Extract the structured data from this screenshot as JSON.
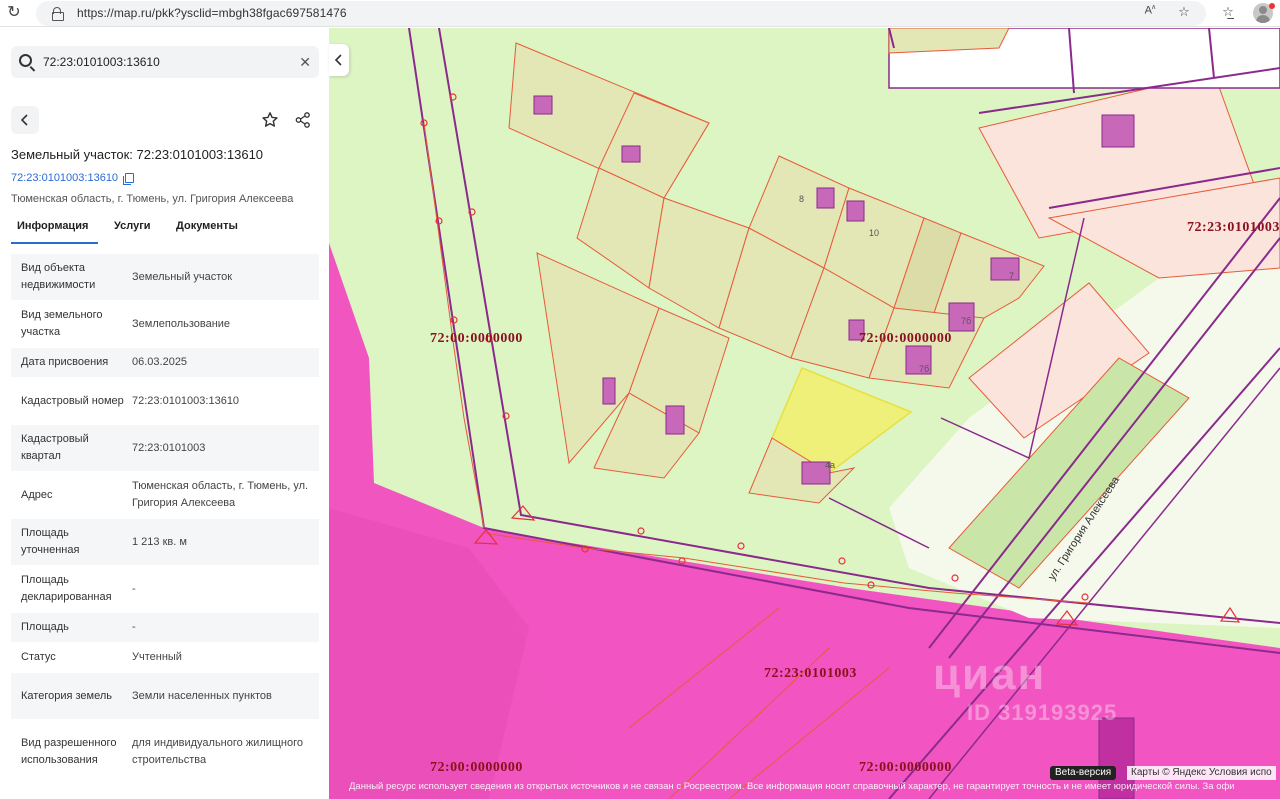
{
  "browser": {
    "url": "https://map.ru/pkk?ysclid=mbgh38fgac697581476",
    "reader_icon": "reader-mode-icon",
    "favorite_icon": "star-icon",
    "collections_icon": "collections-icon"
  },
  "sidebar": {
    "search": {
      "value": "72:23:0101003:13610"
    },
    "title": "Земельный участок: 72:23:0101003:13610",
    "cadastral_link": "72:23:0101003:13610",
    "address": "Тюменская область, г. Тюмень, ул. Григория Алексеева",
    "tabs": [
      "Информация",
      "Услуги",
      "Документы"
    ],
    "rows": [
      {
        "key": "Вид объекта недвижимости",
        "value": "Земельный участок"
      },
      {
        "key": "Вид земельного участка",
        "value": "Землепользование"
      },
      {
        "key": "Дата присвоения",
        "value": "06.03.2025"
      },
      {
        "key": "Кадастровый номер",
        "value": "72:23:0101003:13610"
      },
      {
        "key": "Кадастровый квартал",
        "value": "72:23:0101003"
      },
      {
        "key": "Адрес",
        "value": "Тюменская область, г. Тюмень, ул. Григория Алексеева"
      },
      {
        "key": "Площадь уточненная",
        "value": "1 213 кв. м"
      },
      {
        "key": "Площадь декларированная",
        "value": "-"
      },
      {
        "key": "Площадь",
        "value": "-"
      },
      {
        "key": "Статус",
        "value": "Учтенный"
      },
      {
        "key": "Категория земель",
        "value": "Земли населенных пунктов"
      },
      {
        "key": "Вид разрешенного использования",
        "value": "для индивидуального жилищного строительства"
      }
    ]
  },
  "map": {
    "quarter_labels": [
      "72:00:0000000",
      "72:00:0000000",
      "72:23:0101003",
      "72:00:0000000",
      "72:00:0000000",
      "72:23:0101003"
    ],
    "parcel_numbers": [
      "8",
      "10",
      "7",
      "7б",
      "7б",
      "4а"
    ],
    "street": "ул. Григория Алексеева",
    "watermark_logo": "циан",
    "watermark_id": "ID 319193925",
    "beta_label": "Beta-версия",
    "copyright": "Карты © Яндекс  Условия испо",
    "disclaimer": "Данный ресурс использует сведения из открытых источников и не связан с Росреестром. Все информация носит справочный характер, не гарантирует точность и не имеет юридической силы. За офи",
    "colors": {
      "background": "#dcf5c3",
      "zone": "#f055c0",
      "parcel_fill": "#e3e6b5",
      "boundary": "#e85a3a",
      "selected": "#eef07a",
      "road": "#8a2a8c"
    }
  }
}
